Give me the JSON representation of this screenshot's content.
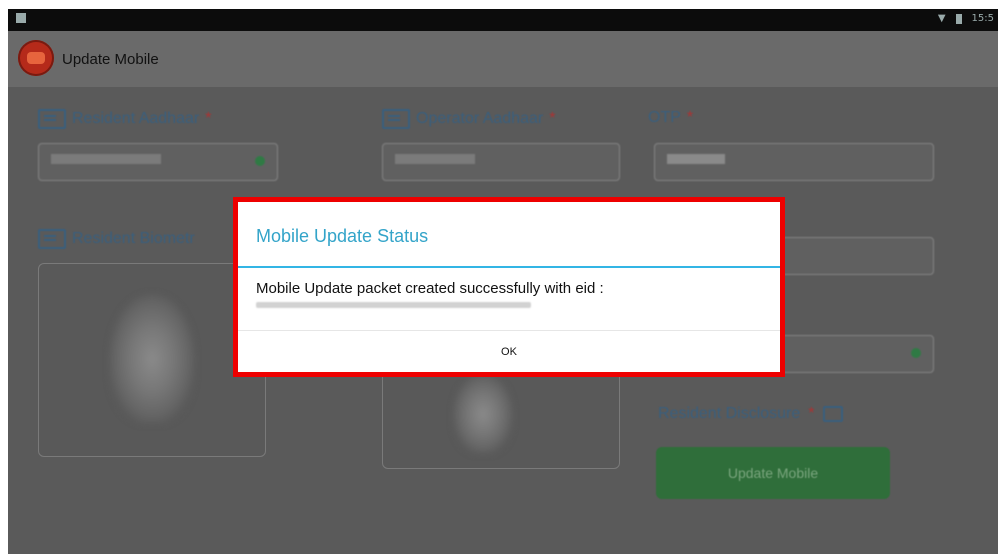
{
  "app": {
    "title": "Update Mobile"
  },
  "form": {
    "resident_aadhaar_label": "Resident Aadhaar",
    "operator_aadhaar_label": "Operator Aadhaar",
    "otp_label": "OTP",
    "required_mark": "*",
    "resident_biometric_label": "Resident Biometr",
    "resident_disclosure_label": "Resident Disclosure",
    "update_button_label": "Update Mobile"
  },
  "status_bar": {
    "time": "15:5"
  },
  "dialog": {
    "title": "Mobile Update Status",
    "message": "Mobile Update packet created successfully with eid :",
    "ok_label": "OK"
  },
  "colors": {
    "dialog_title": "#33a4c9",
    "dialog_divider": "#33b5e5",
    "highlight_border": "#ee0000",
    "update_button": "#2f6e3a"
  }
}
